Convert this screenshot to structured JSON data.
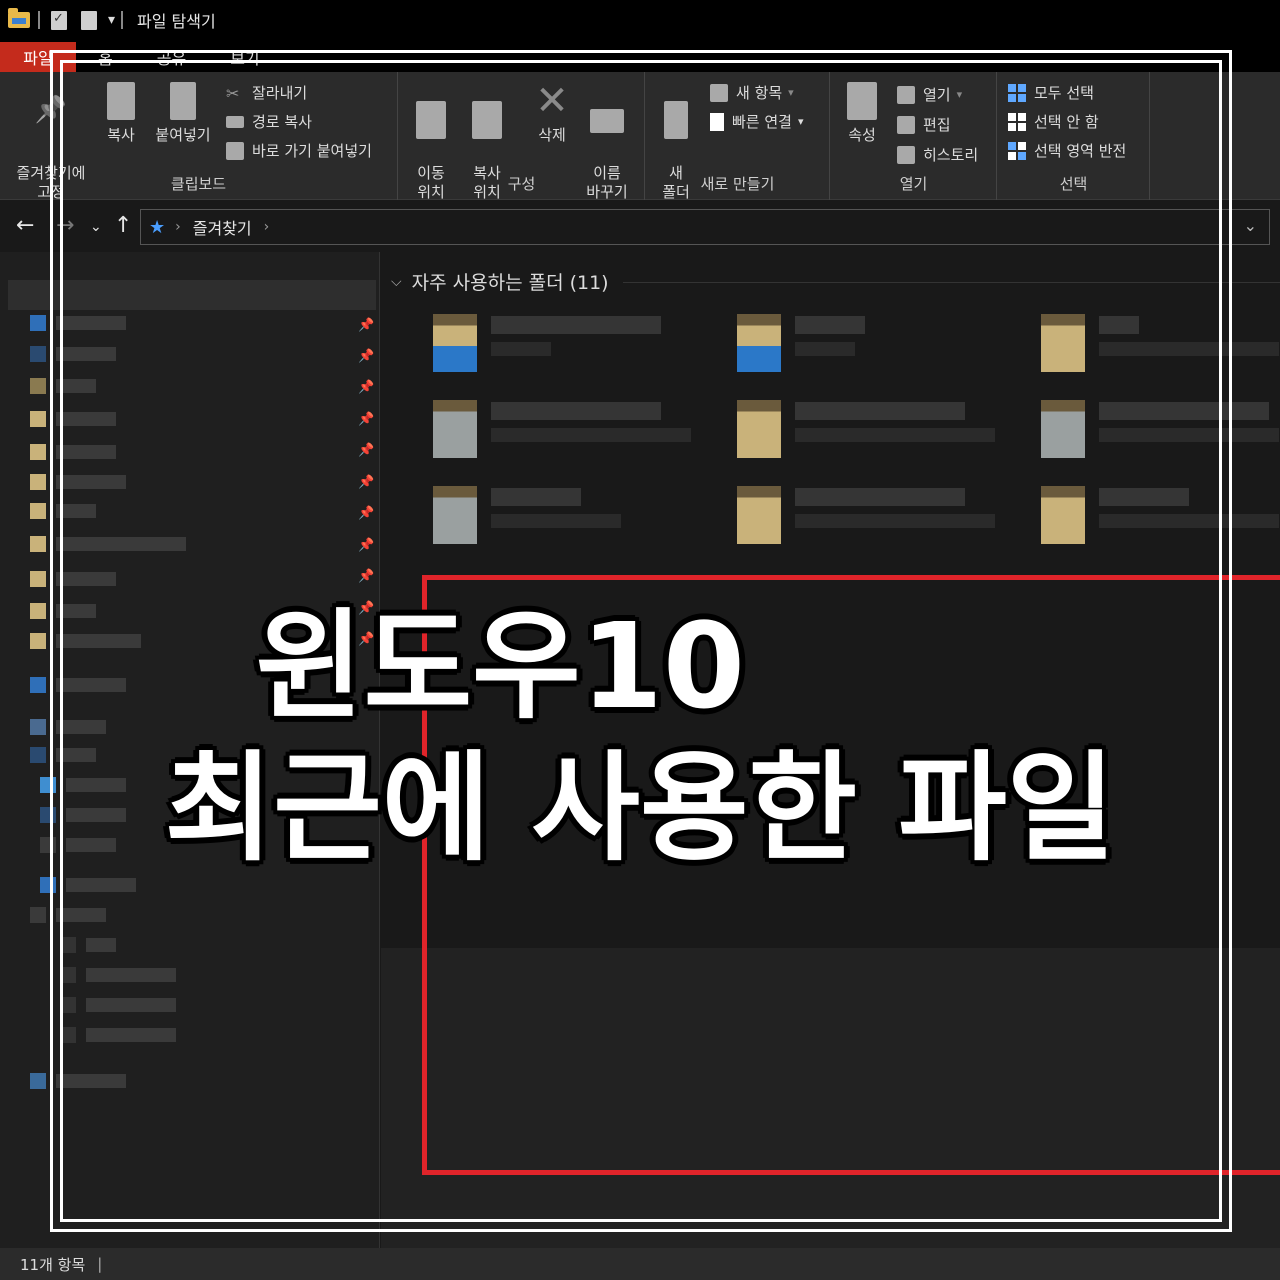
{
  "window": {
    "title": "파일 탐색기"
  },
  "tabs": [
    {
      "label": "파일"
    },
    {
      "label": "홈"
    },
    {
      "label": "공유"
    },
    {
      "label": "보기"
    }
  ],
  "ribbon": {
    "clipboard": {
      "label": "클립보드",
      "pin_quick": "즐겨찾기에\n고정",
      "copy": "복사",
      "paste": "붙여넣기",
      "cut": "잘라내기",
      "copy_path": "경로 복사",
      "paste_shortcut": "바로 가기 붙여넣기"
    },
    "organize": {
      "label": "구성",
      "move_to": "이동\n위치",
      "copy_to": "복사\n위치",
      "delete": "삭제",
      "rename": "이름\n바꾸기"
    },
    "new": {
      "label": "새로 만들기",
      "new_folder": "새\n폴더",
      "new_item": "새 항목",
      "easy_access": "빠른 연결"
    },
    "open": {
      "label": "열기",
      "properties": "속성",
      "open": "열기",
      "edit": "편집",
      "history": "히스토리"
    },
    "select": {
      "label": "선택",
      "select_all": "모두 선택",
      "select_none": "선택 안 함",
      "invert": "선택 영역 반전"
    }
  },
  "address": {
    "location": "즐겨찾기"
  },
  "content": {
    "section_header": "자주 사용하는 폴더 (11)"
  },
  "status": {
    "count": "11개 항목"
  },
  "overlay": {
    "line1": "윈도우10",
    "line2": "최근에 사용한 파일"
  },
  "colors": {
    "accent_file_tab": "#c42b1c",
    "highlight_red": "#e0242a",
    "star_blue": "#4a9eff"
  },
  "icons": [
    "folder-icon",
    "pin-icon",
    "copy-icon",
    "paste-icon",
    "scissors-icon",
    "delete-icon",
    "star-icon"
  ]
}
